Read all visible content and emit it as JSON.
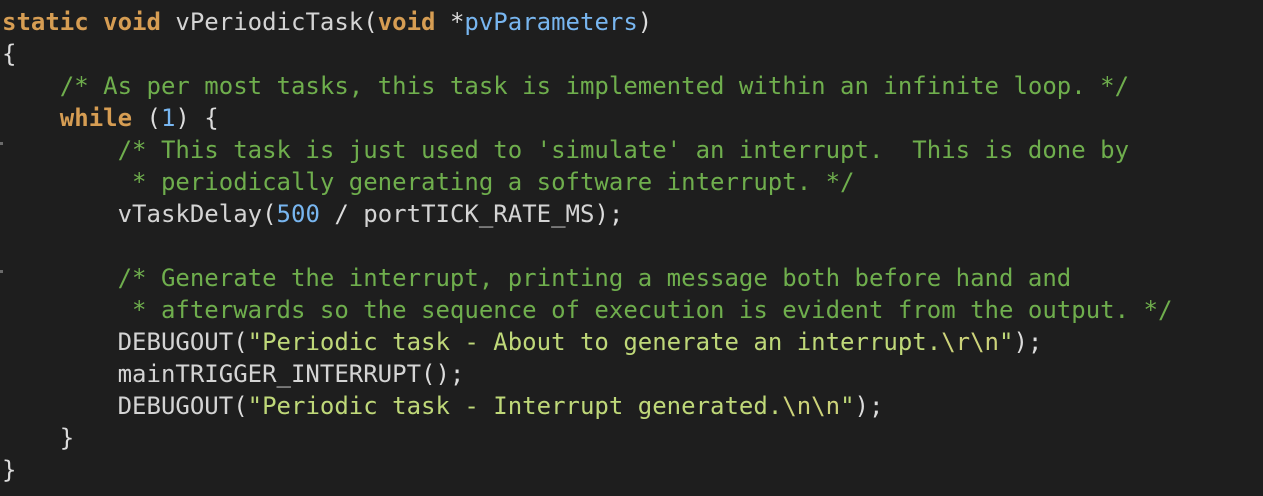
{
  "code": {
    "function_keyword_static": "static",
    "function_keyword_void": "void",
    "function_name": "vPeriodicTask",
    "param_type": "void",
    "param_name": "pvParameters",
    "open_brace": "{",
    "comment_loop": "/* As per most tasks, this task is implemented within an infinite loop. */",
    "while_keyword": "while",
    "while_arg": "1",
    "comment_simulate_1": "/* This task is just used to 'simulate' an interrupt.  This is done by",
    "comment_simulate_2": " * periodically generating a software interrupt. */",
    "delay_call": "vTaskDelay",
    "delay_value": "500",
    "delay_rest": "portTICK_RATE_MS",
    "comment_generate_1": "/* Generate the interrupt, printing a message both before hand and",
    "comment_generate_2": " * afterwards so the sequence of execution is evident from the output. */",
    "debug_call_1": "DEBUGOUT",
    "debug_str_1": "\"Periodic task - About to generate an interrupt.",
    "debug_esc_1a": "\\r",
    "debug_esc_1b": "\\n",
    "trigger_call": "mainTRIGGER_INTERRUPT",
    "debug_call_2": "DEBUGOUT",
    "debug_str_2": "\"Periodic task - Interrupt generated.",
    "debug_esc_2a": "\\n",
    "debug_esc_2b": "\\n",
    "close_inner_brace": "}",
    "close_outer_brace": "}"
  },
  "colors": {
    "background": "#1e1e1e",
    "keyword": "#d69d53",
    "comment": "#6fae4d",
    "number": "#78b6f0",
    "string": "#bfd879",
    "default": "#dcdcdc"
  }
}
